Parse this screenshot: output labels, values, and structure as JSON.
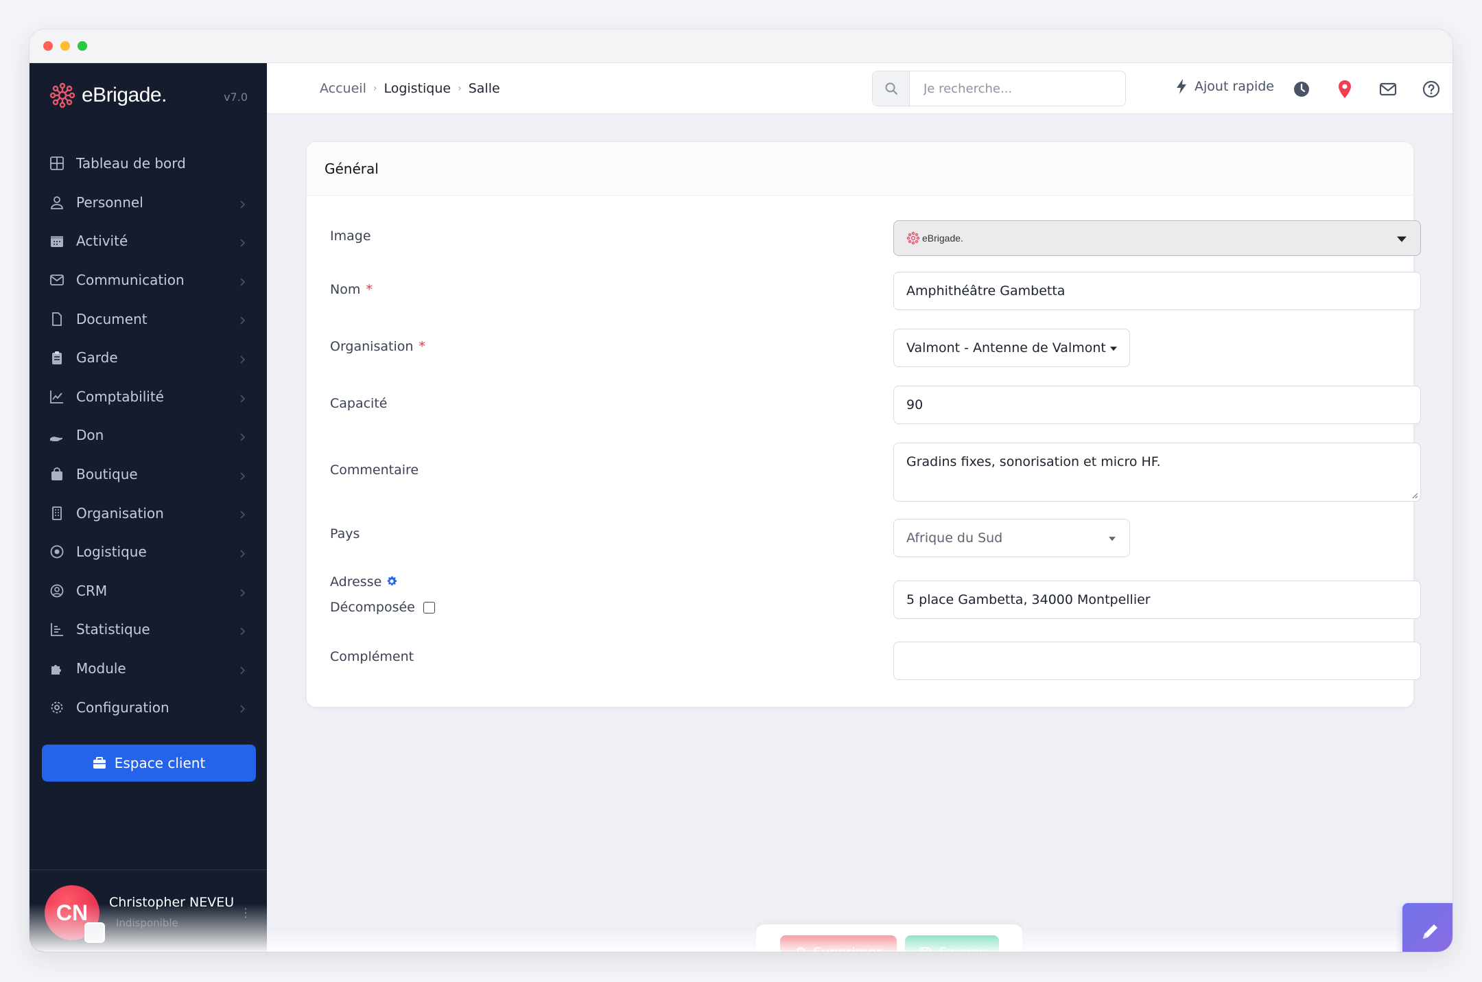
{
  "app": {
    "brand": "eBrigade.",
    "version": "v7.0"
  },
  "sidebar": {
    "items": [
      {
        "label": "Tableau de bord",
        "icon": "grid-icon"
      },
      {
        "label": "Personnel",
        "icon": "user-icon"
      },
      {
        "label": "Activité",
        "icon": "calendar-icon"
      },
      {
        "label": "Communication",
        "icon": "envelope-icon"
      },
      {
        "label": "Document",
        "icon": "file-icon"
      },
      {
        "label": "Garde",
        "icon": "clipboard-icon"
      },
      {
        "label": "Comptabilité",
        "icon": "chart-line-icon"
      },
      {
        "label": "Don",
        "icon": "hand-holding-icon"
      },
      {
        "label": "Boutique",
        "icon": "shopping-bag-icon"
      },
      {
        "label": "Organisation",
        "icon": "building-icon"
      },
      {
        "label": "Logistique",
        "icon": "dot-circle-icon"
      },
      {
        "label": "CRM",
        "icon": "user-circle-icon"
      },
      {
        "label": "Statistique",
        "icon": "bar-chart-icon"
      },
      {
        "label": "Module",
        "icon": "puzzle-icon"
      },
      {
        "label": "Configuration",
        "icon": "gear-icon"
      }
    ],
    "client_button": "Espace client",
    "user": {
      "initials": "CN",
      "name": "Christopher NEVEU",
      "status": "Indisponible"
    }
  },
  "header": {
    "breadcrumb": [
      "Accueil",
      "Logistique",
      "Salle"
    ],
    "search_placeholder": "Je recherche...",
    "quick_add": "Ajout rapide"
  },
  "form": {
    "section_title": "Général",
    "image_label": "Image",
    "image_value": "eBrigade.",
    "nom_label": "Nom",
    "nom_value": "Amphithéâtre Gambetta",
    "organisation_label": "Organisation",
    "organisation_value": "Valmont - Antenne de Valmont",
    "capacite_label": "Capacité",
    "capacite_value": "90",
    "commentaire_label": "Commentaire",
    "commentaire_value": "Gradins fixes, sonorisation et micro HF.",
    "pays_label": "Pays",
    "pays_value": "Afrique du Sud",
    "adresse_label": "Adresse",
    "decomposee_label": "Décomposée",
    "adresse_value": "5 place Gambetta, 34000 Montpellier",
    "complement_label": "Complément",
    "complement_value": "",
    "required_marker": "*"
  },
  "actions": {
    "delete_label": "Supprimer",
    "save_label": "Sauver"
  },
  "colors": {
    "sidebar_bg": "#141c2e",
    "primary": "#2563eb",
    "danger": "#f27a84",
    "success": "#6cd7b3",
    "brand_red": "#e8586a"
  }
}
